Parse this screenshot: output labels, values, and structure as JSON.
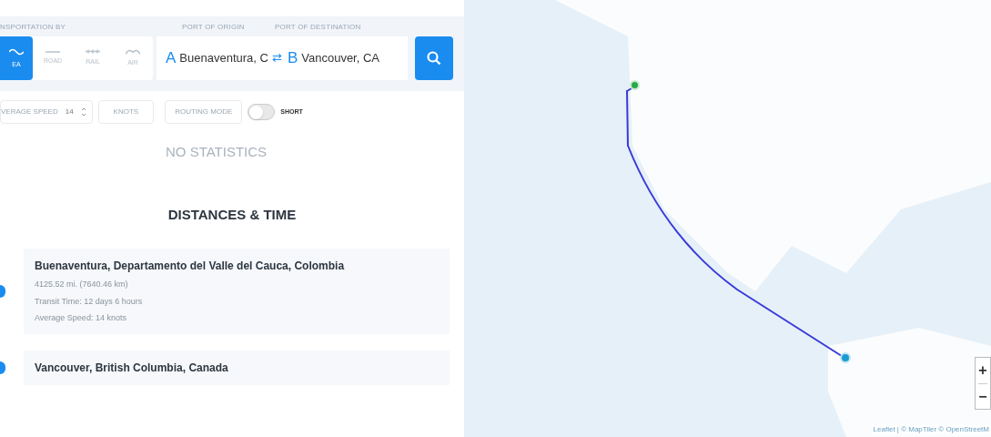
{
  "search_bar": {
    "transport_label": "NSPORTATION BY",
    "origin_label": "PORT OF ORIGIN",
    "destination_label": "PORT OF DESTINATION",
    "modes": [
      {
        "kind": "sea",
        "label": "EA",
        "selected": true
      },
      {
        "kind": "road",
        "label": "ROAD",
        "selected": false
      },
      {
        "kind": "rail",
        "label": "RAIL",
        "selected": false
      },
      {
        "kind": "air",
        "label": "AIR",
        "selected": false
      }
    ],
    "origin": {
      "marker": "A",
      "value": "Buenaventura, C"
    },
    "swap": "⇄",
    "destination": {
      "marker": "B",
      "value": "Vancouver, CA"
    }
  },
  "options": {
    "speed_label": "VERAGE SPEED",
    "speed_value": "14",
    "units": "KNOTS",
    "routing_label": "ROUTING MODE",
    "toggle": {
      "on": false,
      "label": "SHORT"
    }
  },
  "statistics": "NO STATISTICS",
  "section_title": "DISTANCES & TIME",
  "legs": [
    {
      "title": "Buenaventura, Departamento del Valle del Cauca, Colombia",
      "lines": [
        "4125.52 mi. (7640.46 km)",
        "Transit Time: 12 days 6 hours",
        "Average Speed: 14 knots"
      ]
    },
    {
      "title": "Vancouver, British Columbia, Canada"
    }
  ],
  "map": {
    "zoom_in": "+",
    "zoom_out": "−",
    "attribution": "Leaflet | © MapTiler © OpenStreetM"
  }
}
